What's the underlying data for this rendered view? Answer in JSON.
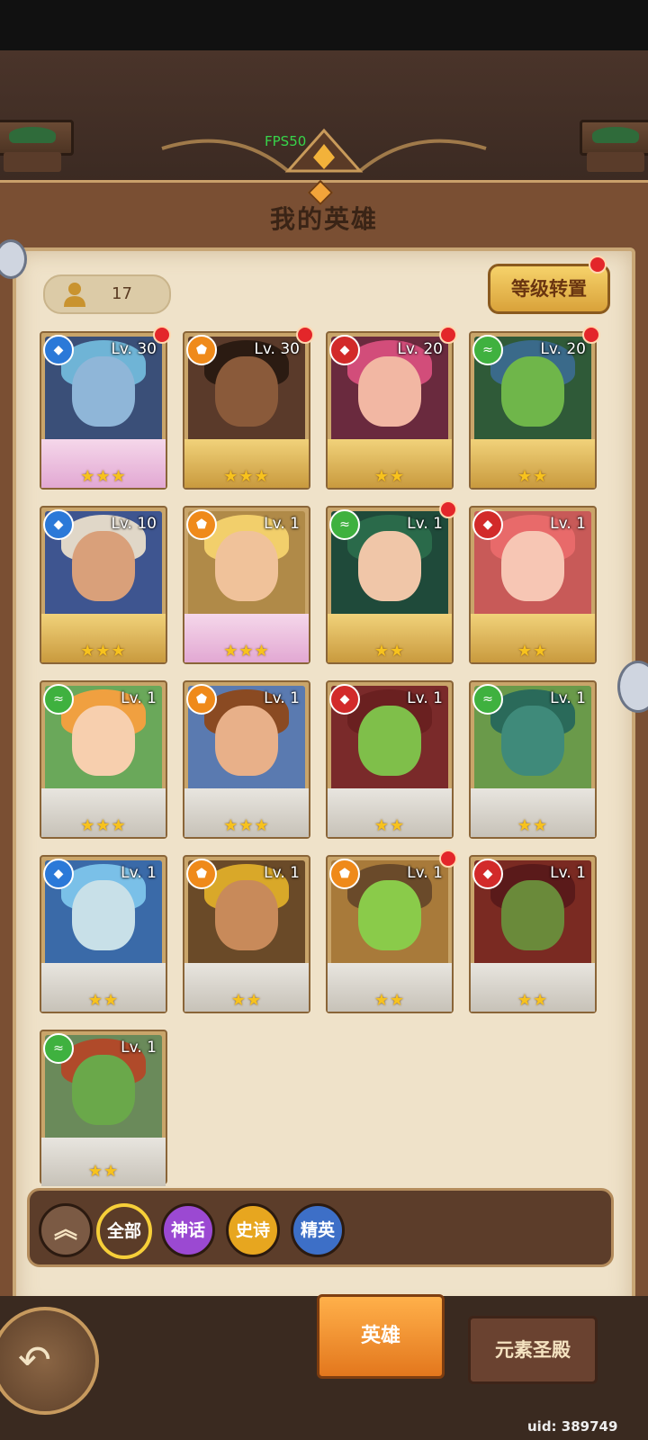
{
  "status": {
    "fps": "FPS50"
  },
  "header": {
    "title": "我的英雄"
  },
  "hero_count": "17",
  "level_transfer_label": "等级转置",
  "heroes": [
    {
      "lv": "Lv. 30",
      "element": "water",
      "stars": "★★★",
      "frame": "myth",
      "dot": true,
      "skin": "#8fb6d8",
      "hair": "#6fb4d6",
      "bg": "#3a4f78"
    },
    {
      "lv": "Lv. 30",
      "element": "fire",
      "stars": "★★★",
      "frame": "gold",
      "dot": true,
      "skin": "#8a5a3a",
      "hair": "#2b1b12",
      "bg": "#5a3a2a"
    },
    {
      "lv": "Lv. 20",
      "element": "blood",
      "stars": "★★",
      "frame": "gold",
      "dot": true,
      "skin": "#f2b7a3",
      "hair": "#d24d7a",
      "bg": "#6a2a3e"
    },
    {
      "lv": "Lv. 20",
      "element": "wind",
      "stars": "★★",
      "frame": "gold",
      "dot": true,
      "skin": "#6fb64a",
      "hair": "#3a6a8a",
      "bg": "#2f5a38"
    },
    {
      "lv": "Lv. 10",
      "element": "water",
      "stars": "★★★",
      "frame": "gold",
      "dot": false,
      "skin": "#d9a07a",
      "hair": "#e0d7c8",
      "bg": "#3e5590"
    },
    {
      "lv": "Lv. 1",
      "element": "fire",
      "stars": "★★★",
      "frame": "myth",
      "dot": false,
      "skin": "#f0c29a",
      "hair": "#f2cf6b",
      "bg": "#b08a48"
    },
    {
      "lv": "Lv. 1",
      "element": "wind",
      "stars": "★★",
      "frame": "gold",
      "dot": true,
      "skin": "#f0c6a8",
      "hair": "#2a6a4a",
      "bg": "#1f4a3a"
    },
    {
      "lv": "Lv. 1",
      "element": "blood",
      "stars": "★★",
      "frame": "gold",
      "dot": false,
      "skin": "#f7c6b4",
      "hair": "#e86a6a",
      "bg": "#c85a58"
    },
    {
      "lv": "Lv. 1",
      "element": "wind",
      "stars": "★★★",
      "frame": "plain",
      "dot": false,
      "skin": "#f7cfae",
      "hair": "#f0a040",
      "bg": "#6aa85a"
    },
    {
      "lv": "Lv. 1",
      "element": "fire",
      "stars": "★★★",
      "frame": "plain",
      "dot": false,
      "skin": "#e8b089",
      "hair": "#8a4a22",
      "bg": "#5a7ab0"
    },
    {
      "lv": "Lv. 1",
      "element": "blood",
      "stars": "★★",
      "frame": "plain",
      "dot": false,
      "skin": "#7fbf4a",
      "hair": "#6a2020",
      "bg": "#7a2a2a"
    },
    {
      "lv": "Lv. 1",
      "element": "wind",
      "stars": "★★",
      "frame": "plain",
      "dot": false,
      "skin": "#3f8a7a",
      "hair": "#2a6a5a",
      "bg": "#6a9a4a"
    },
    {
      "lv": "Lv. 1",
      "element": "water",
      "stars": "★★",
      "frame": "plain",
      "dot": false,
      "skin": "#c8e0e8",
      "hair": "#7ac0e8",
      "bg": "#3a6aa8"
    },
    {
      "lv": "Lv. 1",
      "element": "fire",
      "stars": "★★",
      "frame": "plain",
      "dot": false,
      "skin": "#c88a5a",
      "hair": "#d9a829",
      "bg": "#6a4a28"
    },
    {
      "lv": "Lv. 1",
      "element": "fire",
      "stars": "★★",
      "frame": "plain",
      "dot": true,
      "skin": "#8acb4a",
      "hair": "#6a4a2a",
      "bg": "#a87a3a"
    },
    {
      "lv": "Lv. 1",
      "element": "blood",
      "stars": "★★",
      "frame": "plain",
      "dot": false,
      "skin": "#6a8a3a",
      "hair": "#5a1a1a",
      "bg": "#7a2a22"
    },
    {
      "lv": "Lv. 1",
      "element": "wind",
      "stars": "★★",
      "frame": "plain",
      "dot": false,
      "skin": "#6aa84a",
      "hair": "#b04a2a",
      "bg": "#6a8a5a"
    }
  ],
  "filters": {
    "collapse": "︽",
    "all": "全部",
    "myth": "神话",
    "epic": "史诗",
    "elite": "精英"
  },
  "tabs": {
    "hero": "英雄",
    "temple": "元素圣殿"
  },
  "uid": "uid: 389749",
  "colors": {
    "accent": "#f6cf39",
    "badge": "#e3262a",
    "parchment": "#efe2c9"
  }
}
